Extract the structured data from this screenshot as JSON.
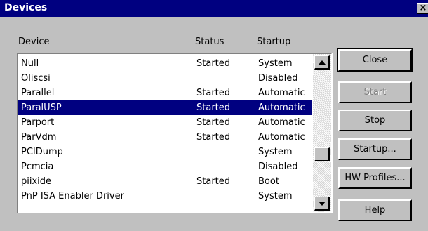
{
  "window": {
    "title": "Devices",
    "close_glyph": "×"
  },
  "columns": {
    "device": "Device",
    "status": "Status",
    "startup": "Startup"
  },
  "devices": [
    {
      "name": "Null",
      "status": "Started",
      "startup": "System"
    },
    {
      "name": "Oliscsi",
      "status": "",
      "startup": "Disabled"
    },
    {
      "name": "Parallel",
      "status": "Started",
      "startup": "Automatic"
    },
    {
      "name": "ParalUSP",
      "status": "Started",
      "startup": "Automatic",
      "selected": true
    },
    {
      "name": "Parport",
      "status": "Started",
      "startup": "Automatic"
    },
    {
      "name": "ParVdm",
      "status": "Started",
      "startup": "Automatic"
    },
    {
      "name": "PCIDump",
      "status": "",
      "startup": "System"
    },
    {
      "name": "Pcmcia",
      "status": "",
      "startup": "Disabled"
    },
    {
      "name": "piixide",
      "status": "Started",
      "startup": "Boot"
    },
    {
      "name": "PnP ISA Enabler Driver",
      "status": "",
      "startup": "System"
    }
  ],
  "buttons": {
    "close": "Close",
    "start": "Start",
    "stop": "Stop",
    "startup": "Startup...",
    "hw_profiles": "HW Profiles...",
    "help": "Help"
  },
  "colors": {
    "titlebar": "#000080",
    "selection": "#000080",
    "face": "#c0c0c0"
  }
}
